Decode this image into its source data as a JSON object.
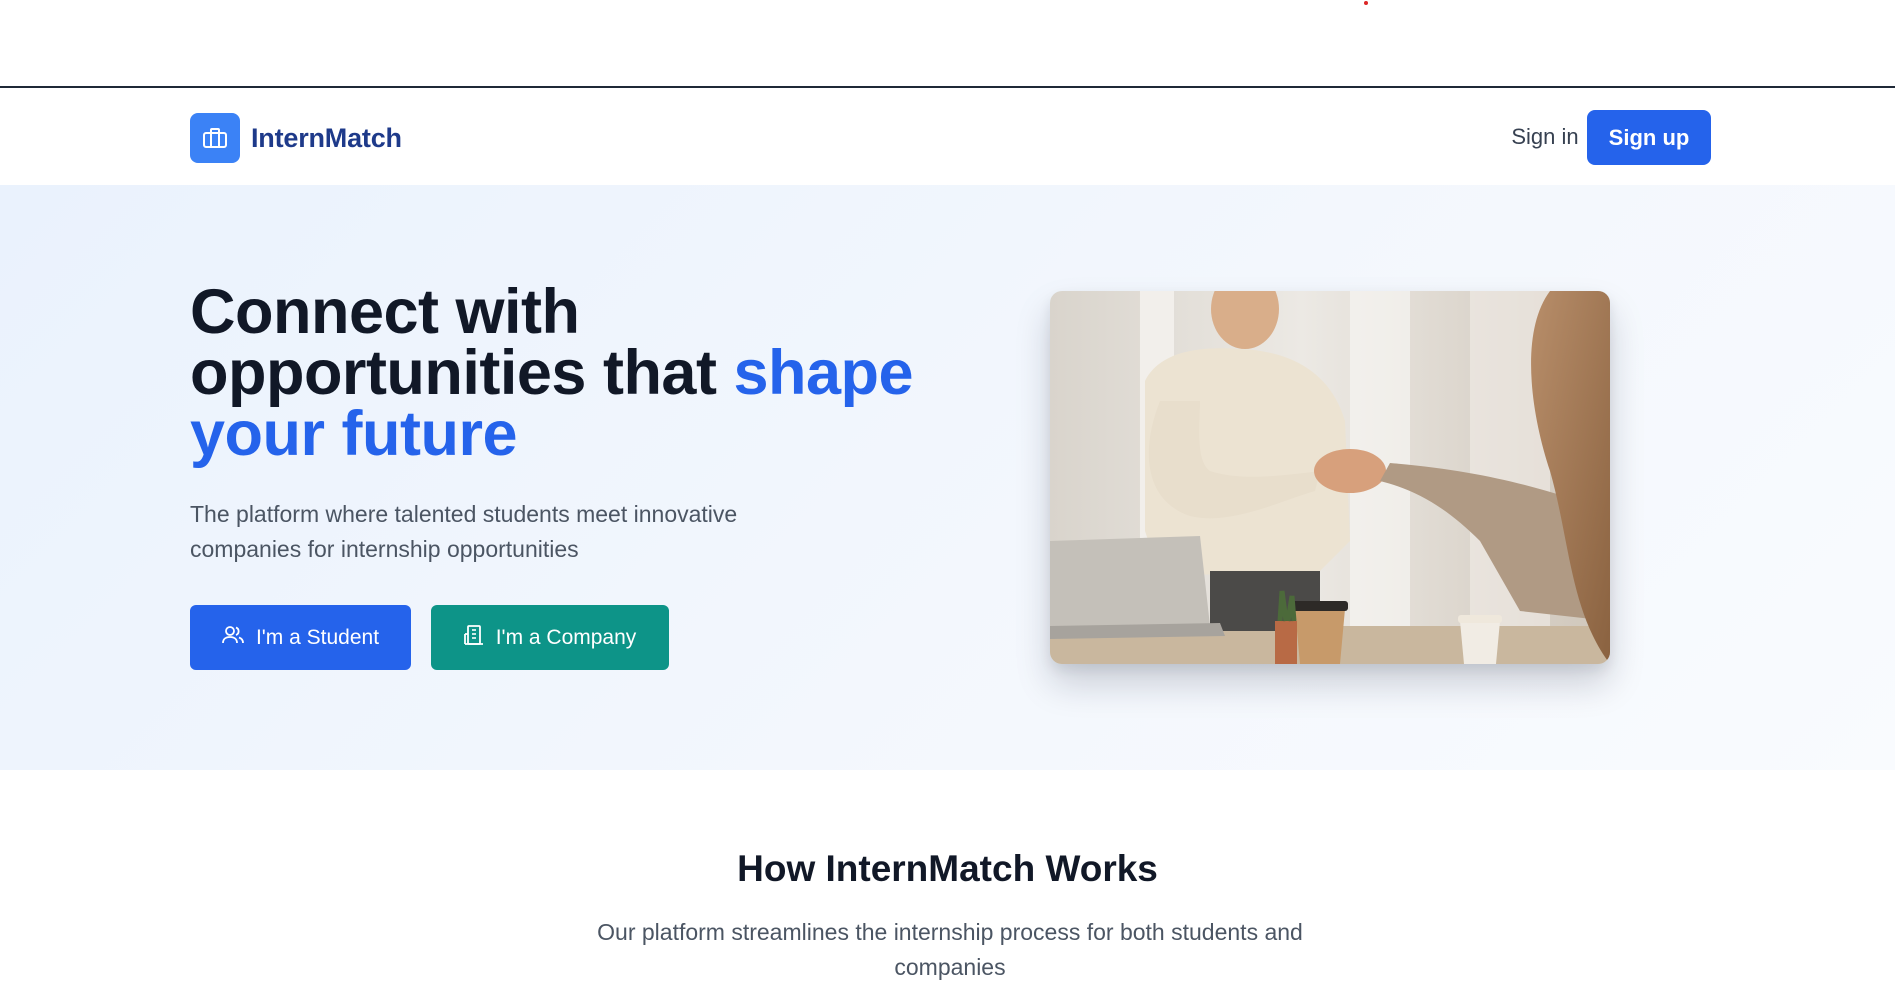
{
  "brand": {
    "name": "InternMatch",
    "logo_icon": "briefcase-icon"
  },
  "nav": {
    "signin_label": "Sign in",
    "signup_label": "Sign up"
  },
  "hero": {
    "title_line1": "Connect with",
    "title_line2": "opportunities that ",
    "title_accent_1": "shape",
    "title_accent_2": "your future",
    "subtitle": "The platform where talented students meet innovative companies for internship opportunities",
    "student_button": "I'm a Student",
    "student_icon": "users-icon",
    "company_button": "I'm a Company",
    "company_icon": "building-icon"
  },
  "how": {
    "title": "How InternMatch Works",
    "subtitle": "Our platform streamlines the internship process for both students and companies"
  },
  "colors": {
    "primary": "#2563eb",
    "brand_text": "#1e3a8a",
    "teal": "#0d9488",
    "hero_bg": "#eef4fd"
  }
}
